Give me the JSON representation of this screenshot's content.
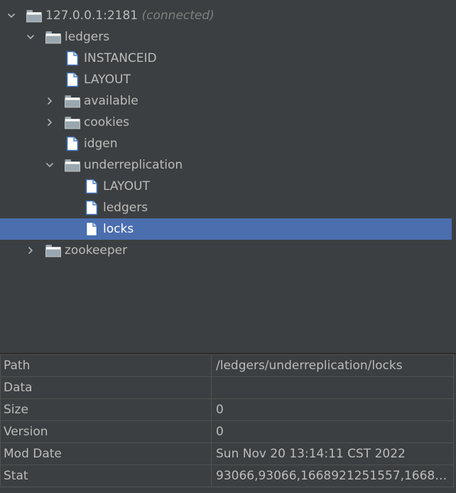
{
  "tree": {
    "root": {
      "label": "127.0.0.1:2181",
      "status": "(connected)"
    },
    "ledgers": "ledgers",
    "instanceid": "INSTANCEID",
    "layout": "LAYOUT",
    "available": "available",
    "cookies": "cookies",
    "idgen": "idgen",
    "underreplication": "underreplication",
    "ur_layout": "LAYOUT",
    "ur_ledgers": "ledgers",
    "ur_locks": "locks",
    "zookeeper": "zookeeper"
  },
  "properties": {
    "rows": [
      {
        "key": "Path",
        "value": "/ledgers/underreplication/locks"
      },
      {
        "key": "Data",
        "value": ""
      },
      {
        "key": "Size",
        "value": "0"
      },
      {
        "key": "Version",
        "value": "0"
      },
      {
        "key": "Mod Date",
        "value": "Sun Nov 20 13:14:11 CST 2022"
      },
      {
        "key": "Stat",
        "value": "93066,93066,1668921251557,16689…"
      }
    ]
  },
  "colors": {
    "background": "#3c3f41",
    "selection": "#4b6eaf",
    "text": "#bbbbbb",
    "muted": "#7f7f7f"
  }
}
